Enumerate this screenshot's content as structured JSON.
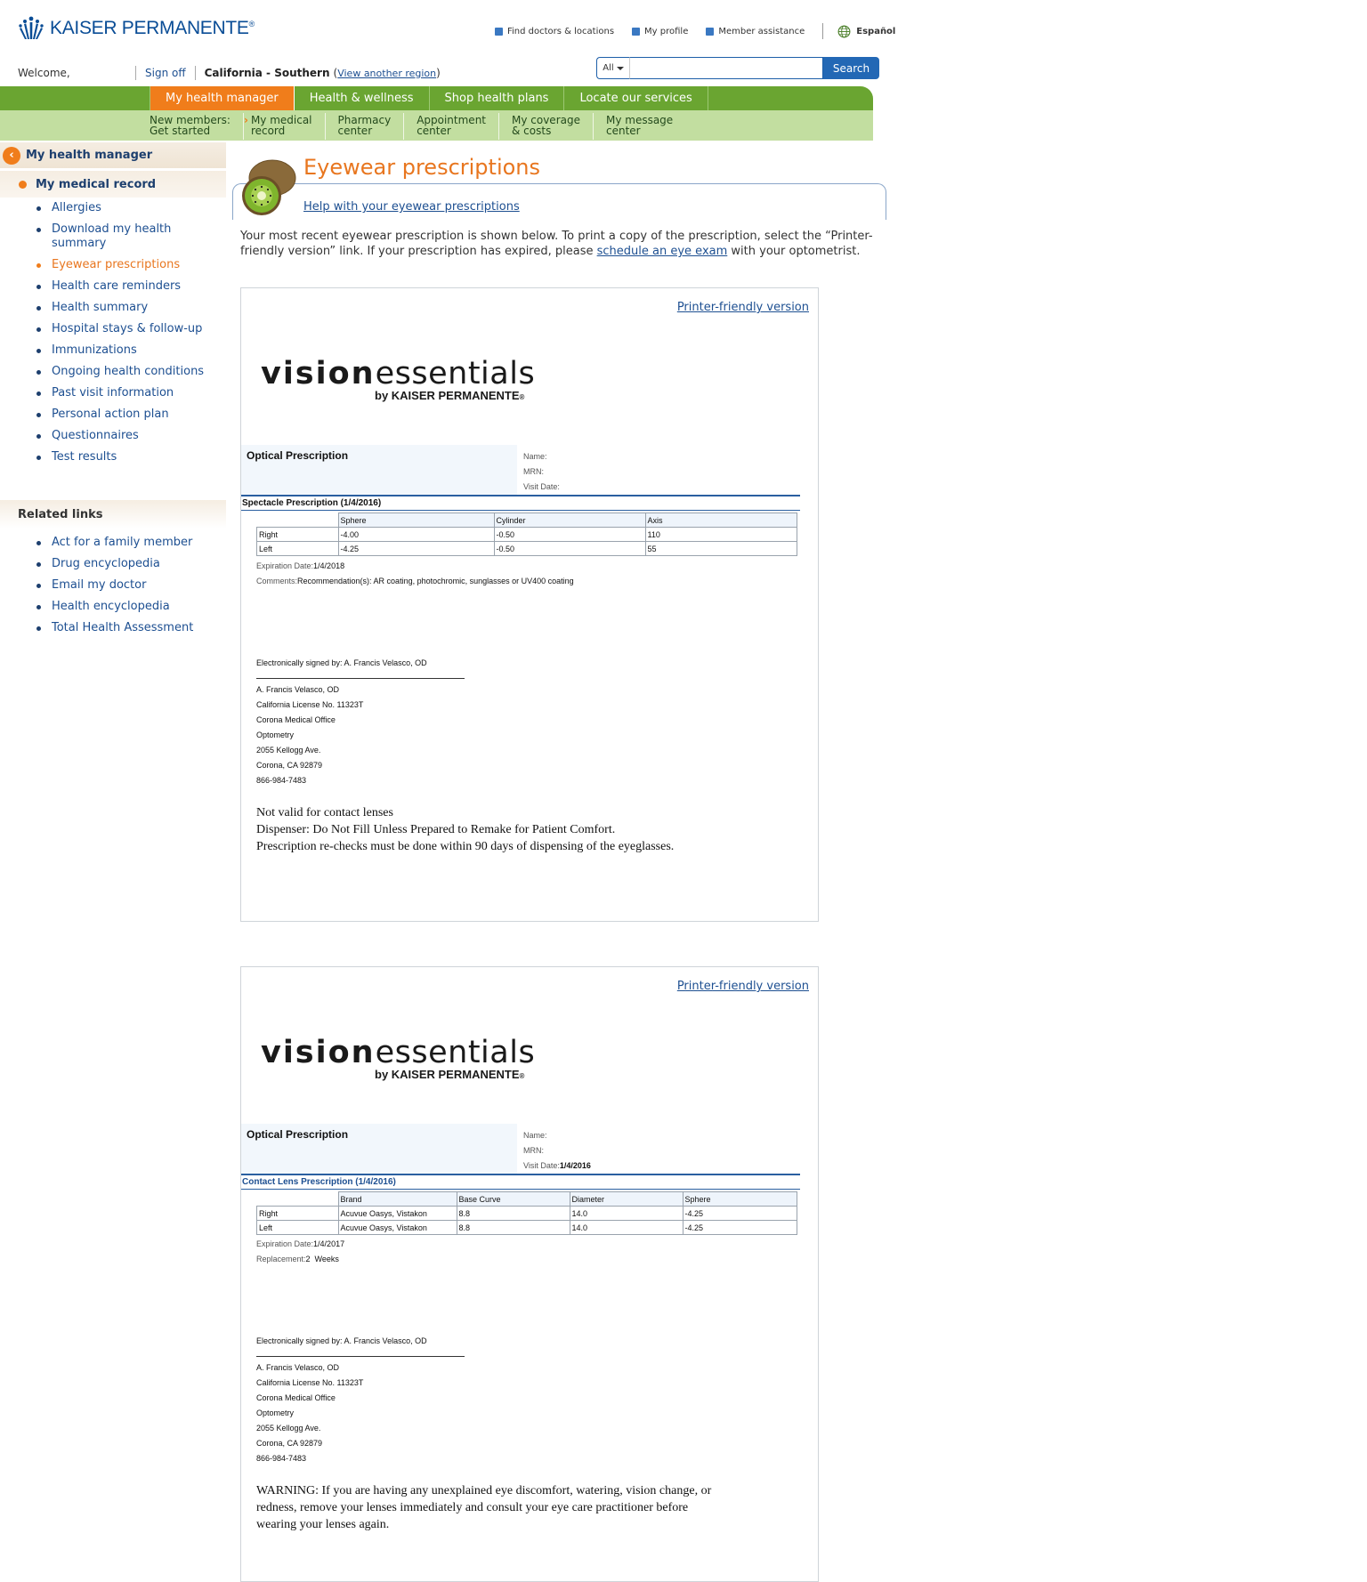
{
  "header": {
    "brand": "KAISER PERMANENTE",
    "brand_mark": "®",
    "utility_links": [
      "Find doctors & locations",
      "My profile",
      "Member assistance"
    ],
    "language": "Español",
    "welcome": "Welcome,",
    "sign_off": "Sign off",
    "region": "California - Southern",
    "region_open": "(",
    "region_link": "View another region",
    "region_close": ")",
    "search_scope": "All",
    "search_value": "",
    "search_button": "Search"
  },
  "nav": {
    "tabs": [
      "My health manager",
      "Health & wellness",
      "Shop health plans",
      "Locate our services"
    ],
    "sub": [
      {
        "l1": "New members:",
        "l2": "Get started"
      },
      {
        "l1": "My medical",
        "l2": "record"
      },
      {
        "l1": "Pharmacy",
        "l2": "center"
      },
      {
        "l1": "Appointment",
        "l2": "center"
      },
      {
        "l1": "My coverage",
        "l2": "& costs"
      },
      {
        "l1": "My message",
        "l2": "center"
      }
    ]
  },
  "sidebar": {
    "title": "My health manager",
    "section": "My medical record",
    "items": [
      "Allergies",
      "Download my health summary",
      "Eyewear prescriptions",
      "Health care reminders",
      "Health summary",
      "Hospital stays & follow-up",
      "Immunizations",
      "Ongoing health conditions",
      "Past visit information",
      "Personal action plan",
      "Questionnaires",
      "Test results"
    ],
    "related_title": "Related links",
    "related": [
      "Act for a family member",
      "Drug encyclopedia",
      "Email my doctor",
      "Health encyclopedia",
      "Total Health Assessment"
    ]
  },
  "main": {
    "title": "Eyewear prescriptions",
    "help_link": "Help with your eyewear prescriptions",
    "intro_1": "Your most recent eyewear prescription is shown below. To print a copy of the prescription, select the “Printer-friendly version” link. If your prescription has expired, please",
    "intro_link": "schedule an eye exam",
    "intro_2": "with your optometrist."
  },
  "cards": [
    {
      "printer_link": "Printer-friendly version",
      "logo_bold": "vision",
      "logo_light": "essentials",
      "logo_by": "by KAISER PERMANENTE",
      "logo_mark": "®",
      "optical": "Optical Prescription",
      "name_label": "Name:",
      "mrn_label": "MRN:",
      "visit_label": "Visit Date:",
      "visit_value": "",
      "type": "Spectacle Prescription (1/4/2016)",
      "columns": [
        "",
        "Sphere",
        "Cylinder",
        "Axis"
      ],
      "rows": [
        [
          "Right",
          "-4.00",
          "-0.50",
          "110"
        ],
        [
          "Left",
          "-4.25",
          "-0.50",
          "55"
        ]
      ],
      "exp_label": "Expiration Date:",
      "exp_value": "1/4/2018",
      "extra_label": "Comments:",
      "extra_value": "Recommendation(s): AR coating, photochromic, sunglasses or UV400 coating",
      "signed": "Electronically signed by: A. Francis Velasco, OD",
      "sig_lines": [
        "A. Francis Velasco, OD",
        "California License No. 11323T",
        "Corona Medical Office",
        "Optometry",
        "2055 Kellogg Ave.",
        "Corona, CA 92879",
        "866-984-7483"
      ],
      "notes": [
        "Not valid for contact lenses",
        "Dispenser: Do Not Fill Unless Prepared to Remake for Patient Comfort.",
        "Prescription re-checks must be done within 90 days of dispensing of the eyeglasses."
      ]
    },
    {
      "printer_link": "Printer-friendly version",
      "logo_bold": "vision",
      "logo_light": "essentials",
      "logo_by": "by KAISER PERMANENTE",
      "logo_mark": "®",
      "optical": "Optical Prescription",
      "name_label": "Name:",
      "mrn_label": "MRN:",
      "visit_label": "Visit Date:",
      "visit_value": "1/4/2016",
      "type": "Contact Lens Prescription (1/4/2016)",
      "columns": [
        "",
        "Brand",
        "Base Curve",
        "Diameter",
        "Sphere"
      ],
      "rows": [
        [
          "Right",
          "Acuvue Oasys, Vistakon",
          "8.8",
          "14.0",
          "-4.25"
        ],
        [
          "Left",
          "Acuvue Oasys, Vistakon",
          "8.8",
          "14.0",
          "-4.25"
        ]
      ],
      "exp_label": "Expiration Date:",
      "exp_value": "1/4/2017",
      "extra_label": "Replacement:",
      "extra_value": "2  Weeks",
      "signed": "Electronically signed by: A. Francis Velasco, OD",
      "sig_lines": [
        "A. Francis Velasco, OD",
        "California License No. 11323T",
        "Corona Medical Office",
        "Optometry",
        "2055 Kellogg Ave.",
        "Corona, CA 92879",
        "866-984-7483"
      ],
      "notes": [
        "WARNING: If you are having any unexplained eye discomfort, watering, vision change, or",
        "redness, remove your lenses immediately and consult your eye care practitioner before",
        "wearing your lenses again."
      ]
    }
  ],
  "colors": {
    "brand_blue": "#0a4d96",
    "nav_green": "#6aa531",
    "subnav_green": "#c2dea0",
    "accent_orange": "#f07d1b",
    "link_blue": "#1d4f91"
  },
  "icons": [
    "kp-logo-icon",
    "globe-icon",
    "chevron-left-icon",
    "caret-down-icon",
    "kiwi-icon"
  ]
}
